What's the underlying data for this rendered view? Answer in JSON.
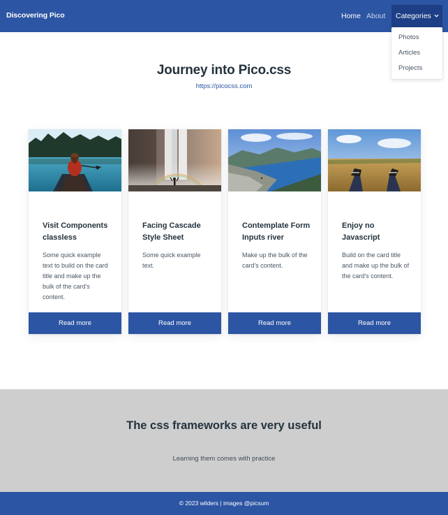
{
  "nav": {
    "brand": "Discovering Pico",
    "links": [
      {
        "label": "Home"
      },
      {
        "label": "About"
      }
    ],
    "categories": {
      "label": "Categories",
      "items": [
        "Photos",
        "Articles",
        "Projects"
      ]
    }
  },
  "hero": {
    "title": "Journey into Pico.css",
    "link": "https://picocss.com"
  },
  "cards": [
    {
      "title": "Visit Components classless",
      "text": "Some quick example text to build on the card title and make up the bulk of the card's content.",
      "button": "Read more",
      "image": "person-in-canoe-on-lake"
    },
    {
      "title": "Facing Cascade Style Sheet",
      "text": "Some quick example text.",
      "button": "Read more",
      "image": "waterfall-with-rainbow"
    },
    {
      "title": "Contemplate Form Inputs river",
      "text": "Make up the bulk of the card's content.",
      "button": "Read more",
      "image": "fjord-river-landscape"
    },
    {
      "title": "Enjoy no Javascript",
      "text": "Build on the card title and make up the bulk of the card's content.",
      "button": "Read more",
      "image": "feet-relaxing-in-field"
    }
  ],
  "banner": {
    "title": "The css frameworks are very useful",
    "text": "Learning them comes with practice"
  },
  "footer": {
    "text": "© 2023 wilders | images @picsum"
  },
  "colors": {
    "primary": "#2c55a3",
    "primary_dark": "#1e3f86",
    "banner_bg": "#cecece",
    "heading": "#24333e"
  }
}
